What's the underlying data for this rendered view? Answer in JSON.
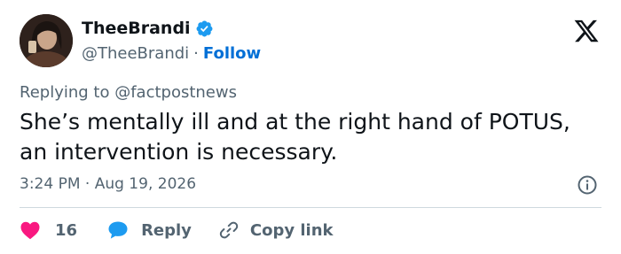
{
  "user": {
    "display_name": "TheeBrandi",
    "handle": "@TheeBrandi",
    "separator": "·",
    "follow_label": "Follow"
  },
  "reply_context": {
    "prefix": "Replying to ",
    "mention": "@factpostnews"
  },
  "tweet": {
    "text": "She’s mentally ill and at the right hand of POTUS, an intervention is necessary.",
    "timestamp": "3:24 PM · Aug 19, 2026"
  },
  "actions": {
    "like_count": "16",
    "reply_label": "Reply",
    "copy_label": "Copy link"
  },
  "colors": {
    "like": "#f91880",
    "reply_bubble": "#1d9bf0",
    "verified": "#1d9bf0",
    "follow": "#006fd6"
  },
  "icons": [
    "verified-badge-icon",
    "x-logo-icon",
    "info-icon",
    "heart-icon",
    "reply-bubble-icon",
    "link-icon"
  ]
}
